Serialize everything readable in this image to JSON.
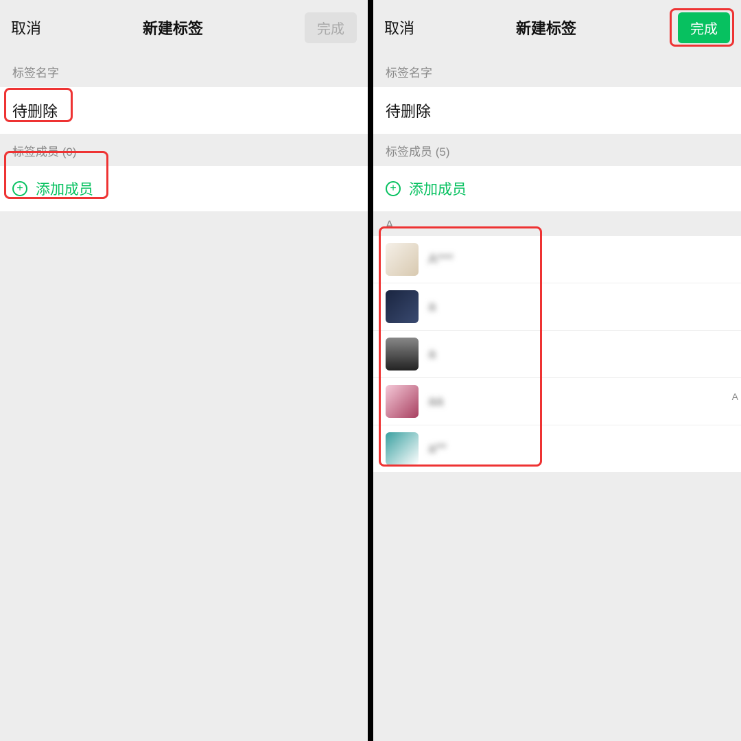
{
  "left": {
    "cancel": "取消",
    "title": "新建标签",
    "done": "完成",
    "tagNameLabel": "标签名字",
    "tagNameValue": "待删除",
    "membersLabel": "标签成员 (0)",
    "addMemberLabel": "添加成员"
  },
  "right": {
    "cancel": "取消",
    "title": "新建标签",
    "done": "完成",
    "tagNameLabel": "标签名字",
    "tagNameValue": "待删除",
    "membersLabel": "标签成员 (5)",
    "addMemberLabel": "添加成员",
    "indexLetter": "A",
    "sideIndex": "A",
    "members": {
      "m1": "A***",
      "m2": "a",
      "m3": "a",
      "m4": "aa",
      "m5": "a**"
    }
  }
}
